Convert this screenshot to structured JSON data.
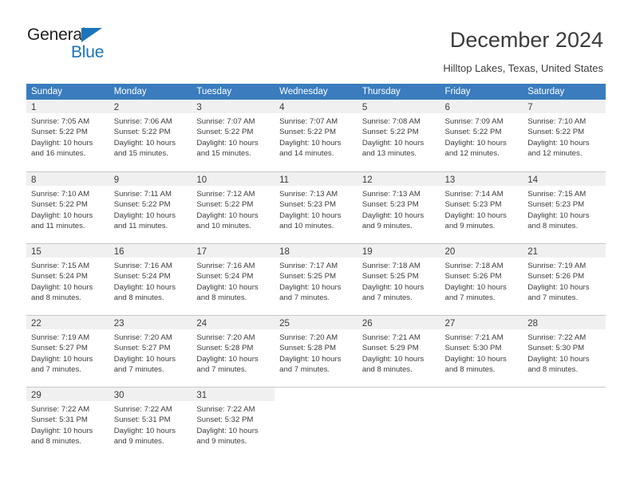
{
  "logo": {
    "text_top": "General",
    "text_bottom": "Blue",
    "accent_color": "#1b75bb"
  },
  "header": {
    "title": "December 2024",
    "subtitle": "Hilltop Lakes, Texas, United States"
  },
  "theme": {
    "header_bar_color": "#3a7cbe",
    "day_band_color": "#f0f0f0",
    "text_color": "#3c3c3c",
    "grid_line_color": "#c8c8c8"
  },
  "weekdays": [
    "Sunday",
    "Monday",
    "Tuesday",
    "Wednesday",
    "Thursday",
    "Friday",
    "Saturday"
  ],
  "weeks": [
    [
      {
        "day": "1",
        "sunrise": "Sunrise: 7:05 AM",
        "sunset": "Sunset: 5:22 PM",
        "daylight1": "Daylight: 10 hours",
        "daylight2": "and 16 minutes."
      },
      {
        "day": "2",
        "sunrise": "Sunrise: 7:06 AM",
        "sunset": "Sunset: 5:22 PM",
        "daylight1": "Daylight: 10 hours",
        "daylight2": "and 15 minutes."
      },
      {
        "day": "3",
        "sunrise": "Sunrise: 7:07 AM",
        "sunset": "Sunset: 5:22 PM",
        "daylight1": "Daylight: 10 hours",
        "daylight2": "and 15 minutes."
      },
      {
        "day": "4",
        "sunrise": "Sunrise: 7:07 AM",
        "sunset": "Sunset: 5:22 PM",
        "daylight1": "Daylight: 10 hours",
        "daylight2": "and 14 minutes."
      },
      {
        "day": "5",
        "sunrise": "Sunrise: 7:08 AM",
        "sunset": "Sunset: 5:22 PM",
        "daylight1": "Daylight: 10 hours",
        "daylight2": "and 13 minutes."
      },
      {
        "day": "6",
        "sunrise": "Sunrise: 7:09 AM",
        "sunset": "Sunset: 5:22 PM",
        "daylight1": "Daylight: 10 hours",
        "daylight2": "and 12 minutes."
      },
      {
        "day": "7",
        "sunrise": "Sunrise: 7:10 AM",
        "sunset": "Sunset: 5:22 PM",
        "daylight1": "Daylight: 10 hours",
        "daylight2": "and 12 minutes."
      }
    ],
    [
      {
        "day": "8",
        "sunrise": "Sunrise: 7:10 AM",
        "sunset": "Sunset: 5:22 PM",
        "daylight1": "Daylight: 10 hours",
        "daylight2": "and 11 minutes."
      },
      {
        "day": "9",
        "sunrise": "Sunrise: 7:11 AM",
        "sunset": "Sunset: 5:22 PM",
        "daylight1": "Daylight: 10 hours",
        "daylight2": "and 11 minutes."
      },
      {
        "day": "10",
        "sunrise": "Sunrise: 7:12 AM",
        "sunset": "Sunset: 5:22 PM",
        "daylight1": "Daylight: 10 hours",
        "daylight2": "and 10 minutes."
      },
      {
        "day": "11",
        "sunrise": "Sunrise: 7:13 AM",
        "sunset": "Sunset: 5:23 PM",
        "daylight1": "Daylight: 10 hours",
        "daylight2": "and 10 minutes."
      },
      {
        "day": "12",
        "sunrise": "Sunrise: 7:13 AM",
        "sunset": "Sunset: 5:23 PM",
        "daylight1": "Daylight: 10 hours",
        "daylight2": "and 9 minutes."
      },
      {
        "day": "13",
        "sunrise": "Sunrise: 7:14 AM",
        "sunset": "Sunset: 5:23 PM",
        "daylight1": "Daylight: 10 hours",
        "daylight2": "and 9 minutes."
      },
      {
        "day": "14",
        "sunrise": "Sunrise: 7:15 AM",
        "sunset": "Sunset: 5:23 PM",
        "daylight1": "Daylight: 10 hours",
        "daylight2": "and 8 minutes."
      }
    ],
    [
      {
        "day": "15",
        "sunrise": "Sunrise: 7:15 AM",
        "sunset": "Sunset: 5:24 PM",
        "daylight1": "Daylight: 10 hours",
        "daylight2": "and 8 minutes."
      },
      {
        "day": "16",
        "sunrise": "Sunrise: 7:16 AM",
        "sunset": "Sunset: 5:24 PM",
        "daylight1": "Daylight: 10 hours",
        "daylight2": "and 8 minutes."
      },
      {
        "day": "17",
        "sunrise": "Sunrise: 7:16 AM",
        "sunset": "Sunset: 5:24 PM",
        "daylight1": "Daylight: 10 hours",
        "daylight2": "and 8 minutes."
      },
      {
        "day": "18",
        "sunrise": "Sunrise: 7:17 AM",
        "sunset": "Sunset: 5:25 PM",
        "daylight1": "Daylight: 10 hours",
        "daylight2": "and 7 minutes."
      },
      {
        "day": "19",
        "sunrise": "Sunrise: 7:18 AM",
        "sunset": "Sunset: 5:25 PM",
        "daylight1": "Daylight: 10 hours",
        "daylight2": "and 7 minutes."
      },
      {
        "day": "20",
        "sunrise": "Sunrise: 7:18 AM",
        "sunset": "Sunset: 5:26 PM",
        "daylight1": "Daylight: 10 hours",
        "daylight2": "and 7 minutes."
      },
      {
        "day": "21",
        "sunrise": "Sunrise: 7:19 AM",
        "sunset": "Sunset: 5:26 PM",
        "daylight1": "Daylight: 10 hours",
        "daylight2": "and 7 minutes."
      }
    ],
    [
      {
        "day": "22",
        "sunrise": "Sunrise: 7:19 AM",
        "sunset": "Sunset: 5:27 PM",
        "daylight1": "Daylight: 10 hours",
        "daylight2": "and 7 minutes."
      },
      {
        "day": "23",
        "sunrise": "Sunrise: 7:20 AM",
        "sunset": "Sunset: 5:27 PM",
        "daylight1": "Daylight: 10 hours",
        "daylight2": "and 7 minutes."
      },
      {
        "day": "24",
        "sunrise": "Sunrise: 7:20 AM",
        "sunset": "Sunset: 5:28 PM",
        "daylight1": "Daylight: 10 hours",
        "daylight2": "and 7 minutes."
      },
      {
        "day": "25",
        "sunrise": "Sunrise: 7:20 AM",
        "sunset": "Sunset: 5:28 PM",
        "daylight1": "Daylight: 10 hours",
        "daylight2": "and 7 minutes."
      },
      {
        "day": "26",
        "sunrise": "Sunrise: 7:21 AM",
        "sunset": "Sunset: 5:29 PM",
        "daylight1": "Daylight: 10 hours",
        "daylight2": "and 8 minutes."
      },
      {
        "day": "27",
        "sunrise": "Sunrise: 7:21 AM",
        "sunset": "Sunset: 5:30 PM",
        "daylight1": "Daylight: 10 hours",
        "daylight2": "and 8 minutes."
      },
      {
        "day": "28",
        "sunrise": "Sunrise: 7:22 AM",
        "sunset": "Sunset: 5:30 PM",
        "daylight1": "Daylight: 10 hours",
        "daylight2": "and 8 minutes."
      }
    ],
    [
      {
        "day": "29",
        "sunrise": "Sunrise: 7:22 AM",
        "sunset": "Sunset: 5:31 PM",
        "daylight1": "Daylight: 10 hours",
        "daylight2": "and 8 minutes."
      },
      {
        "day": "30",
        "sunrise": "Sunrise: 7:22 AM",
        "sunset": "Sunset: 5:31 PM",
        "daylight1": "Daylight: 10 hours",
        "daylight2": "and 9 minutes."
      },
      {
        "day": "31",
        "sunrise": "Sunrise: 7:22 AM",
        "sunset": "Sunset: 5:32 PM",
        "daylight1": "Daylight: 10 hours",
        "daylight2": "and 9 minutes."
      },
      {
        "day": "",
        "sunrise": "",
        "sunset": "",
        "daylight1": "",
        "daylight2": ""
      },
      {
        "day": "",
        "sunrise": "",
        "sunset": "",
        "daylight1": "",
        "daylight2": ""
      },
      {
        "day": "",
        "sunrise": "",
        "sunset": "",
        "daylight1": "",
        "daylight2": ""
      },
      {
        "day": "",
        "sunrise": "",
        "sunset": "",
        "daylight1": "",
        "daylight2": ""
      }
    ]
  ]
}
